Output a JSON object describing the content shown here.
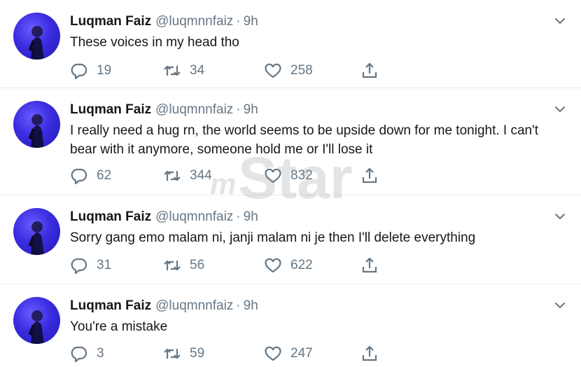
{
  "tweets": [
    {
      "name": "Luqman Faiz",
      "handle": "@luqmnnfaiz",
      "separator": "·",
      "time": "9h",
      "text": "These voices in my head tho",
      "replies": "19",
      "retweets": "34",
      "likes": "258"
    },
    {
      "name": "Luqman Faiz",
      "handle": "@luqmnnfaiz",
      "separator": "·",
      "time": "9h",
      "text": "I really need a hug rn, the world seems to be upside down for me tonight. I can't bear with it anymore, someone hold me or I'll lose it",
      "replies": "62",
      "retweets": "344",
      "likes": "832"
    },
    {
      "name": "Luqman Faiz",
      "handle": "@luqmnnfaiz",
      "separator": "·",
      "time": "9h",
      "text": "Sorry gang emo malam ni, janji malam ni je then I'll delete everything",
      "replies": "31",
      "retweets": "56",
      "likes": "622"
    },
    {
      "name": "Luqman Faiz",
      "handle": "@luqmnnfaiz",
      "separator": "·",
      "time": "9h",
      "text": "You're a mistake",
      "replies": "3",
      "retweets": "59",
      "likes": "247"
    }
  ],
  "watermark": "mStar",
  "icons": {
    "reply": "reply-icon",
    "retweet": "retweet-icon",
    "like": "heart-icon",
    "share": "share-icon",
    "menu": "chevron-down-icon"
  },
  "colors": {
    "text": "#14171a",
    "secondary": "#657786",
    "divider": "#e6ecf0",
    "avatar": "#3a2de0"
  }
}
